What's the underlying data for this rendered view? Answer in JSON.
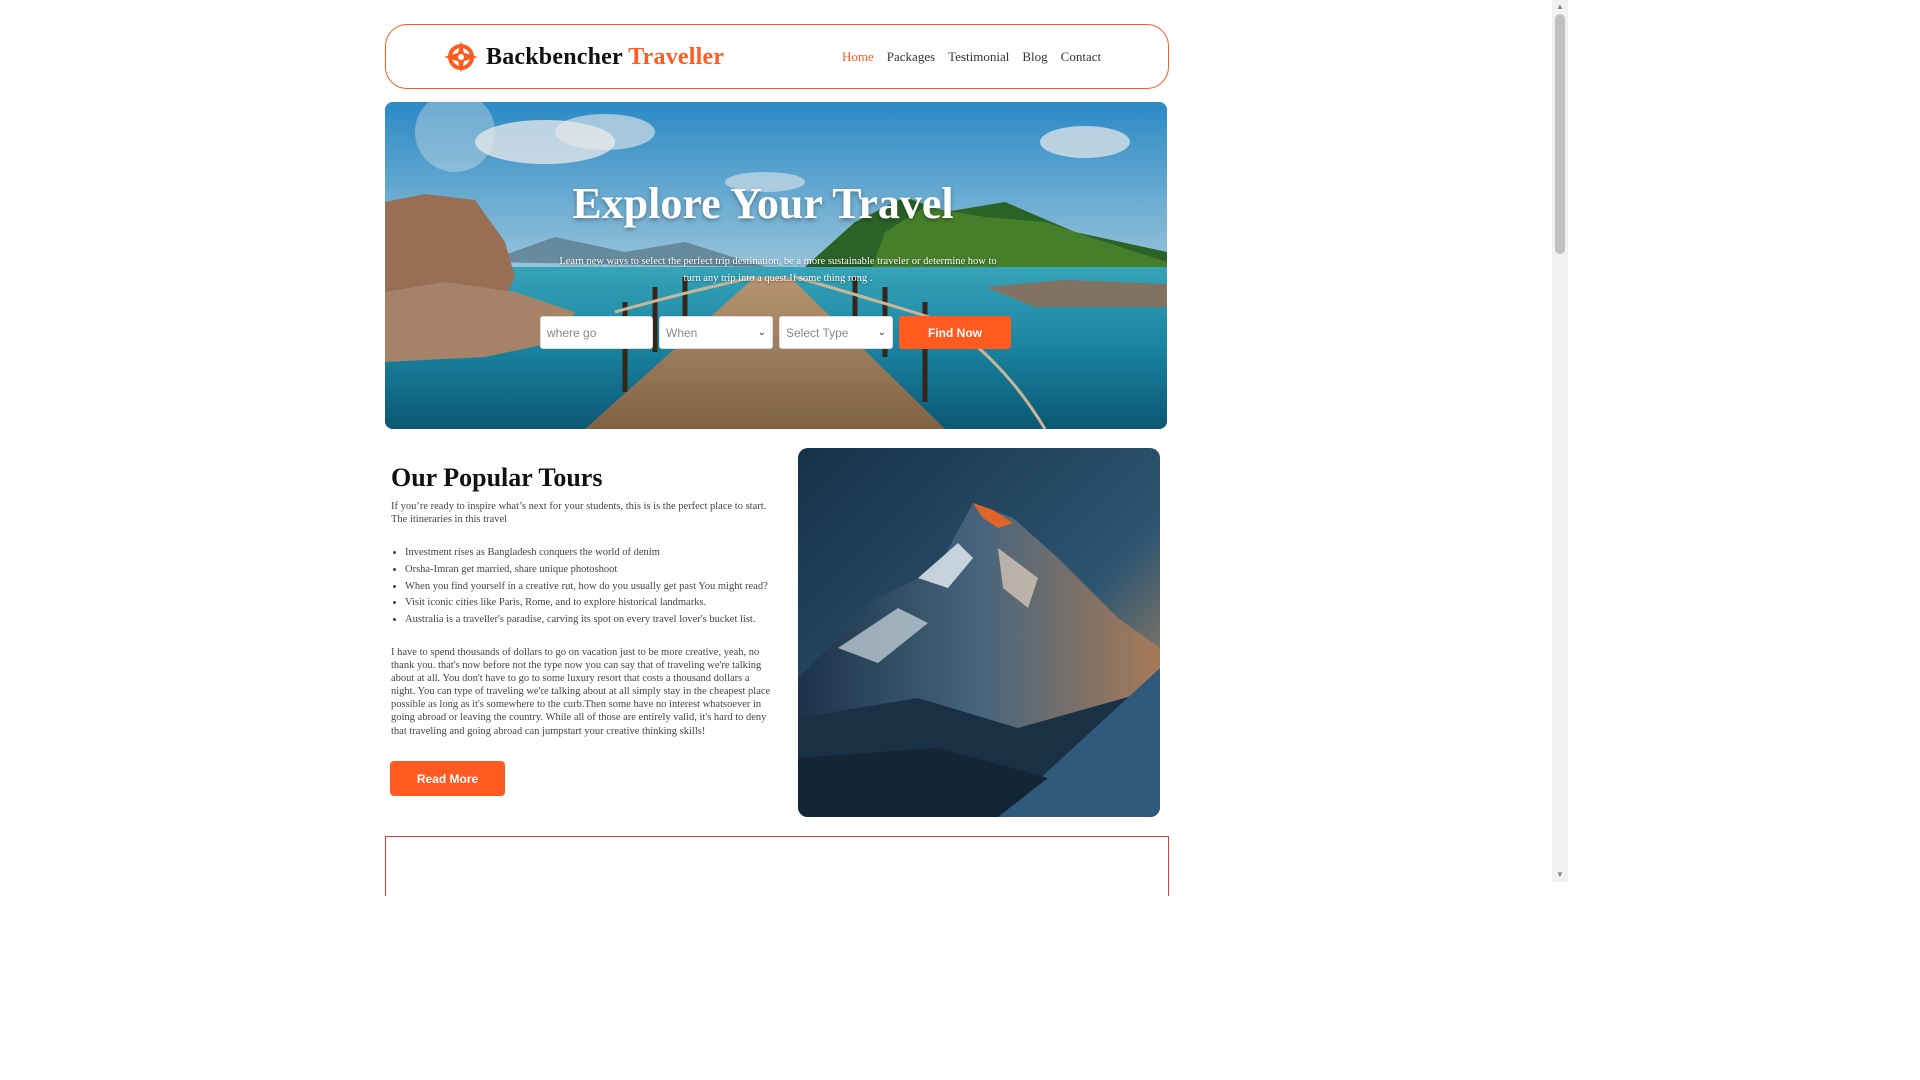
{
  "header": {
    "brand_primary": "Backbencher",
    "brand_accent": "Traveller",
    "accent_color": "#ff5a1f",
    "nav": [
      {
        "label": "Home",
        "active": true
      },
      {
        "label": "Packages",
        "active": false
      },
      {
        "label": "Testimonial",
        "active": false
      },
      {
        "label": "Blog",
        "active": false
      },
      {
        "label": "Contact",
        "active": false
      }
    ]
  },
  "hero": {
    "title": "Explore Your Travel",
    "subtitle": "Learn new ways to select the perfect trip destination, be a more sustainable traveler or determine how to turn any trip into a quest.If some thing rong .",
    "search": {
      "where_placeholder": "where go",
      "when_value": "When",
      "type_value": "Select Type",
      "button_label": "Find Now"
    }
  },
  "tours": {
    "title": "Our Popular Tours",
    "intro": "If you’re ready to inspire what’s next for your students, this is is the perfect place to start. The itineraries in this travel",
    "list": [
      "Investment rises as Bangladesh conquers the world of denim",
      "Orsha-Imran get married, share unique photoshoot",
      "When you find yourself in a creative rut, how do you usually get past You might read?",
      "Visit iconic cities like Paris, Rome, and to explore historical landmarks.",
      "Australia is a traveller's paradise, carving its spot on every travel lover's bucket list."
    ],
    "body": "I have to spend thousands of dollars to go on vacation just to be more creative, yeah, no thank you. that's now before not the type now you can say that of traveling we're talking about at all. You don't have to go to some luxury resort that costs a thousand dollars a night. You can type of traveling we're talking about at all simply stay in the cheapest place possible as long as it's somewhere to the curb.Then some have no interest whatsoever in going abroad or leaving the country. While all of those are entirely valid, it's hard to deny that traveling and going abroad can jumpstart your creative thinking skills!",
    "button_label": "Read More"
  }
}
